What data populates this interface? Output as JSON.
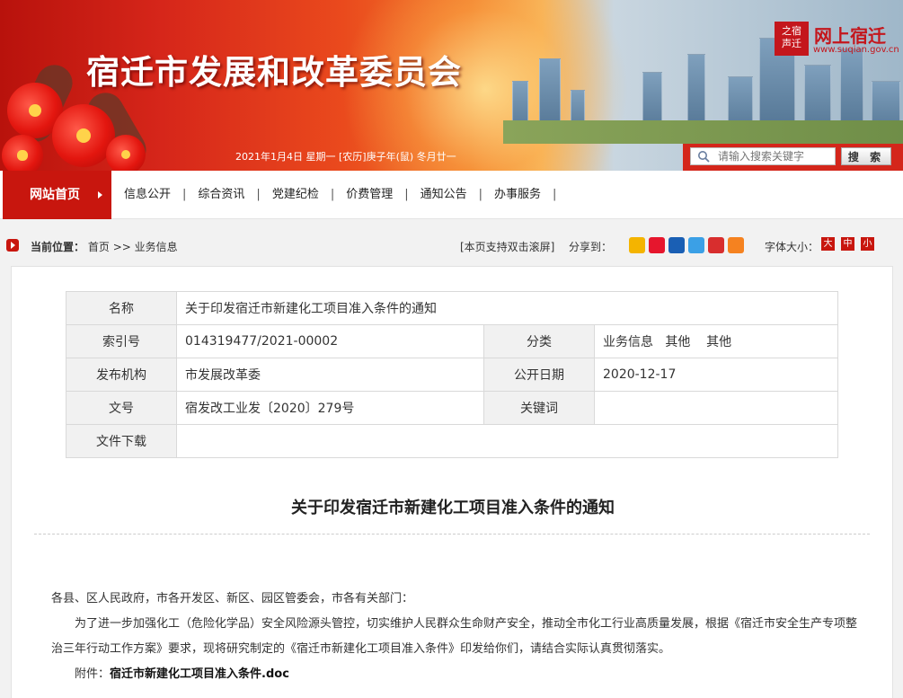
{
  "header": {
    "site_title": "宿迁市发展和改革委员会",
    "date_line": "2021年1月4日  星期一  [农历]庚子年(鼠) 冬月廿一",
    "logo_box_text": "之宿 声迁",
    "logo_text": "网上宿迁",
    "logo_url": "www.suqian.gov.cn",
    "search_placeholder": "请输入搜索关键字",
    "search_button": "搜 索"
  },
  "nav": {
    "home": "网站首页",
    "items": [
      "信息公开",
      "综合资讯",
      "党建纪检",
      "价费管理",
      "通知公告",
      "办事服务"
    ]
  },
  "crumb": {
    "label": "当前位置：",
    "home": "首页",
    "sep": ">>",
    "current": "业务信息",
    "scroll_note": "[本页支持双击滚屏]",
    "share_label": "分享到：",
    "share_icons": [
      "qzone-icon",
      "weibo-icon",
      "renren-icon",
      "tencent-weibo-icon",
      "douban-icon",
      "more-share-icon"
    ],
    "share_colors": [
      "#f4b400",
      "#e6162d",
      "#1a5fb4",
      "#3ba0e6",
      "#d82e2e",
      "#f58220"
    ],
    "font_label": "字体大小：",
    "font_sizes": [
      "大",
      "中",
      "小"
    ]
  },
  "meta": {
    "name_label": "名称",
    "name_value": "关于印发宿迁市新建化工项目准入条件的通知",
    "index_label": "索引号",
    "index_value": "014319477/2021-00002",
    "category_label": "分类",
    "category_value": "业务信息   其他    其他",
    "issuer_label": "发布机构",
    "issuer_value": "市发展改革委",
    "date_label": "公开日期",
    "date_value": "2020-12-17",
    "docno_label": "文号",
    "docno_value": "宿发改工业发〔2020〕279号",
    "keywords_label": "关键词",
    "keywords_value": "",
    "download_label": "文件下载",
    "download_value": ""
  },
  "article": {
    "title": "关于印发宿迁市新建化工项目准入条件的通知",
    "salutation": "各县、区人民政府，市各开发区、新区、园区管委会，市各有关部门：",
    "paragraph": "为了进一步加强化工（危险化学品）安全风险源头管控，切实维护人民群众生命财产安全，推动全市化工行业高质量发展，根据《宿迁市安全生产专项整治三年行动工作方案》要求，现将研究制定的《宿迁市新建化工项目准入条件》印发给你们，请结合实际认真贯彻落实。",
    "attachment_label": "附件：",
    "attachment_name": "宿迁市新建化工项目准入条件.doc"
  }
}
